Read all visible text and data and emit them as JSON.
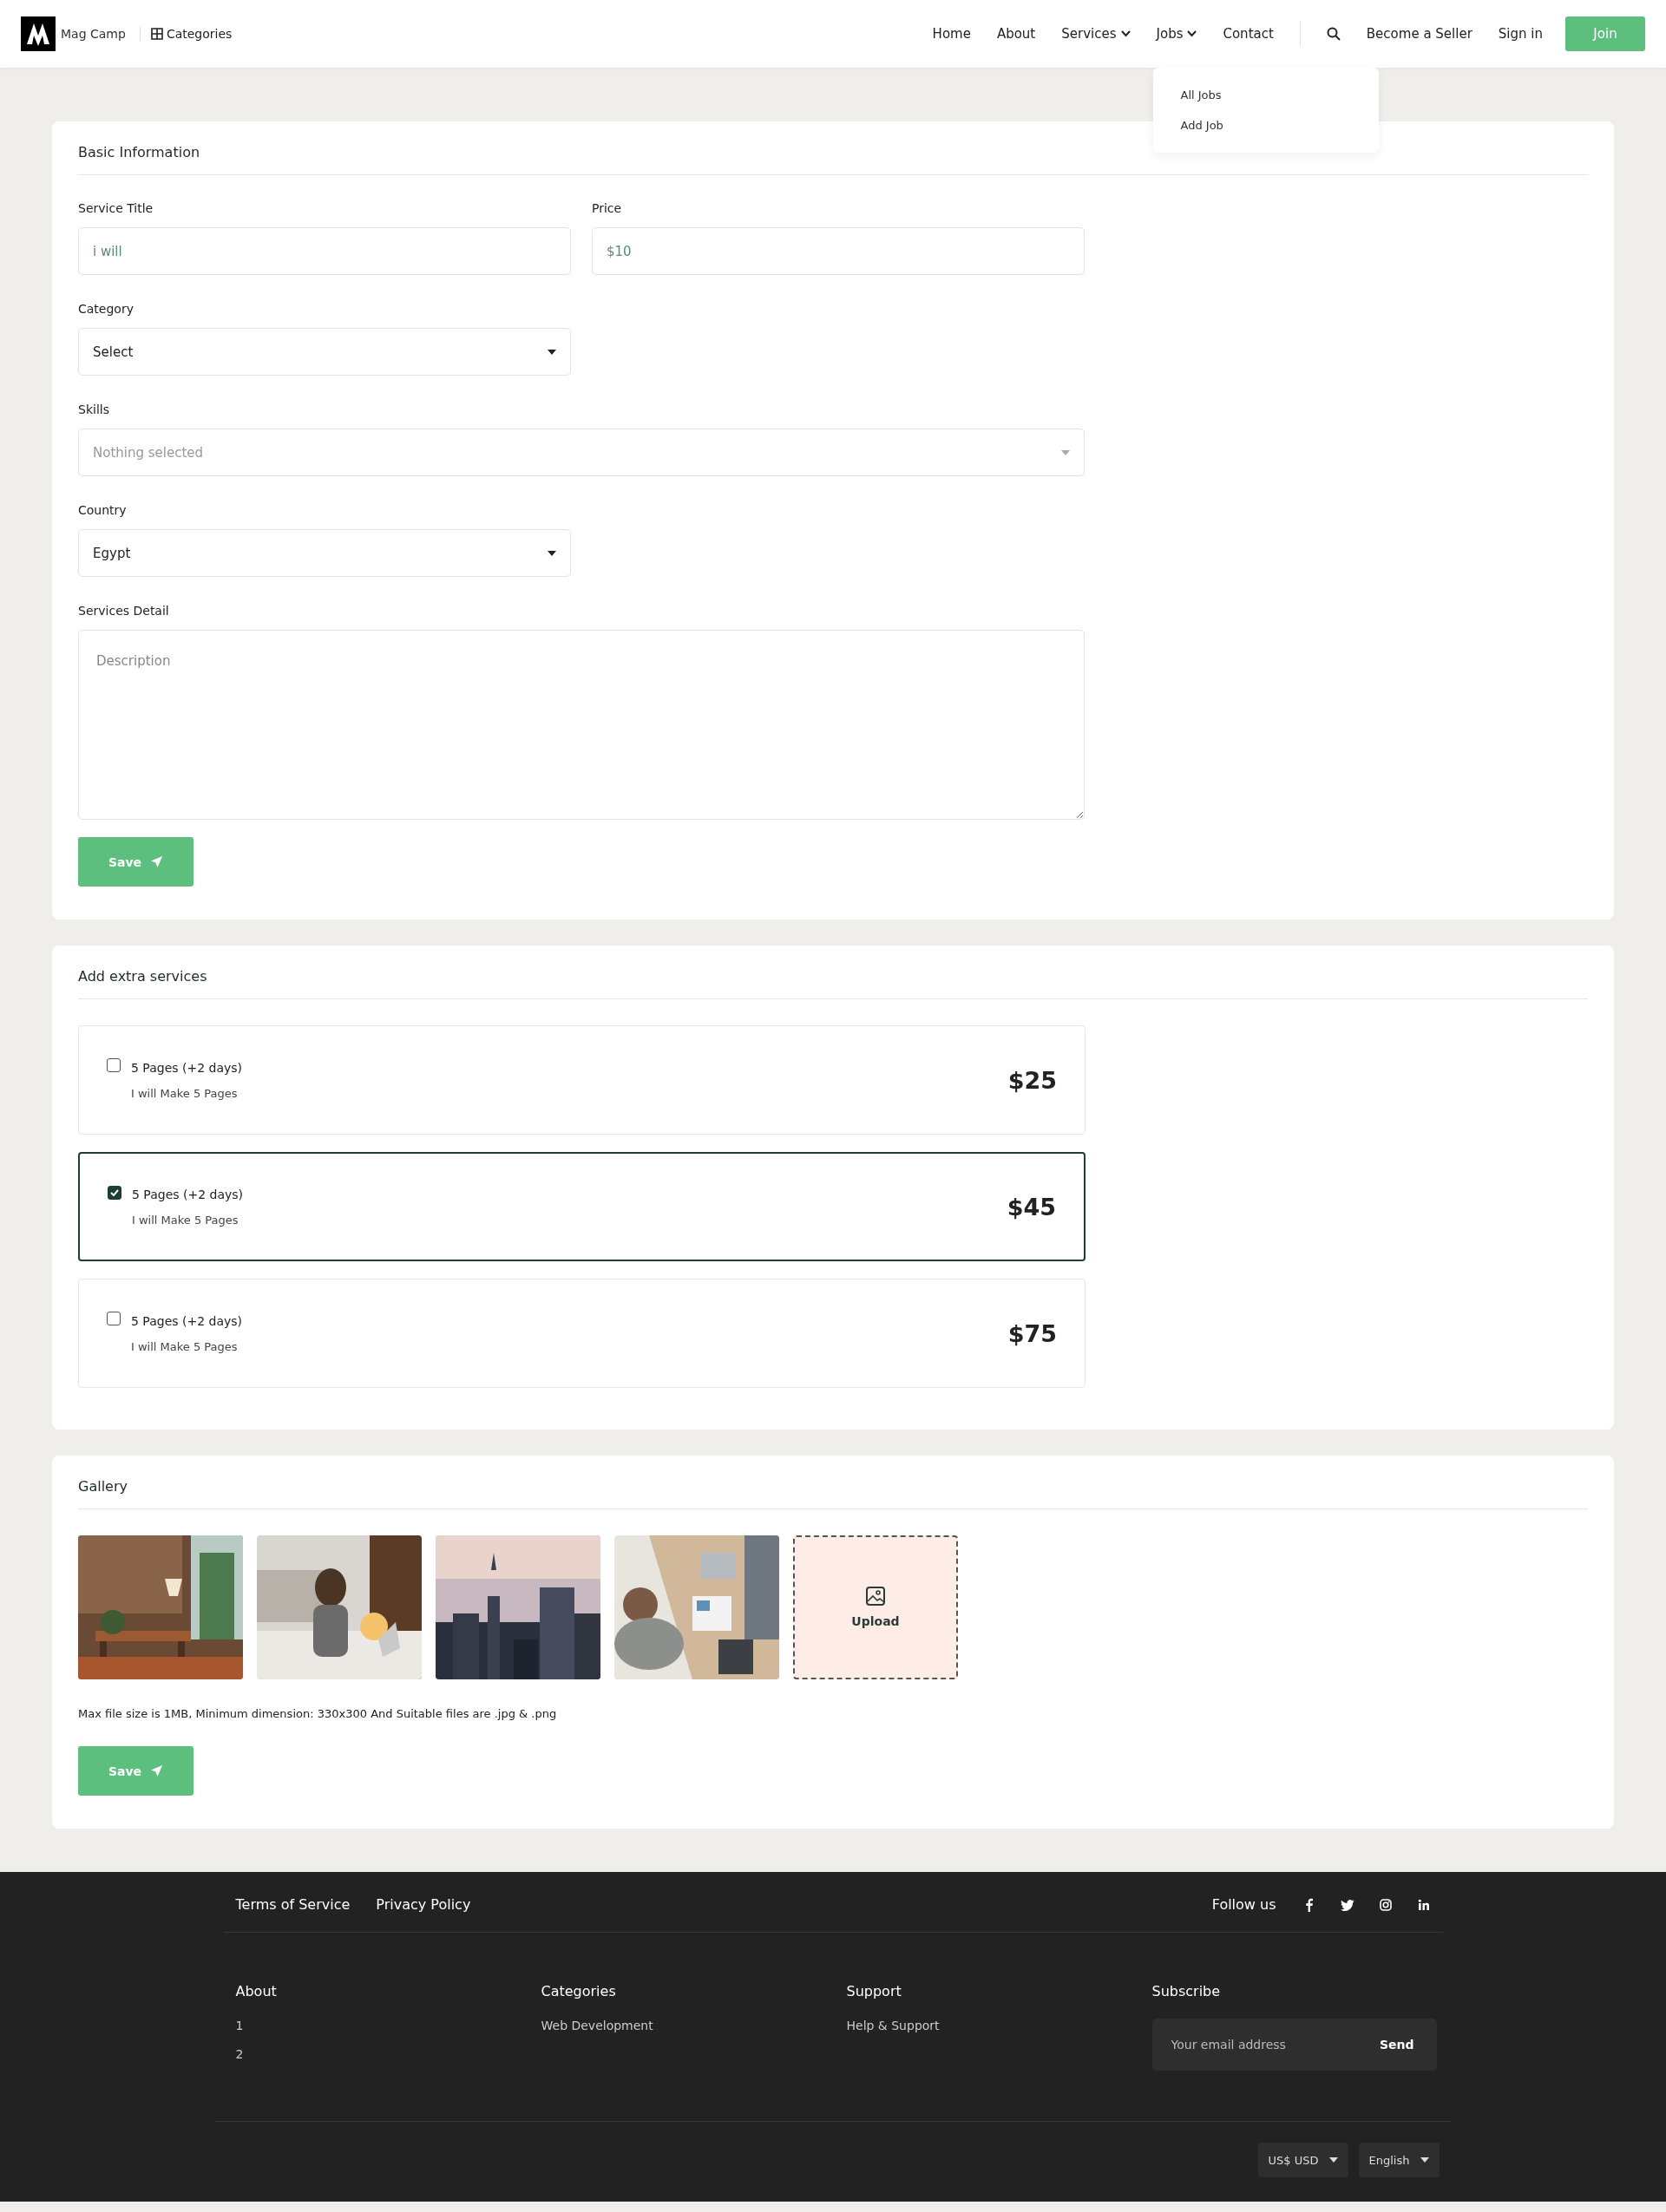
{
  "header": {
    "logo": "Mag Camp",
    "categories": "Categories",
    "nav": [
      {
        "label": "Home",
        "kind": "link"
      },
      {
        "label": "About",
        "kind": "link"
      },
      {
        "label": "Services",
        "kind": "dropdown"
      },
      {
        "label": "Jobs",
        "kind": "dropdown",
        "menu": [
          "All Jobs",
          "Add Job"
        ]
      },
      {
        "label": "Contact",
        "kind": "link"
      }
    ],
    "become_seller": "Become a Seller",
    "sign_in": "Sign in",
    "join": "Join"
  },
  "basic_information": {
    "title": "Basic Information",
    "fields": [
      {
        "label": "Service Title",
        "kind": "text",
        "placeholder": "i will"
      },
      {
        "label": "Price",
        "kind": "text",
        "placeholder": "$10"
      },
      {
        "label": "Category",
        "kind": "select",
        "value": "Select"
      },
      {
        "label": "Skills",
        "kind": "multiselect",
        "placeholder": "Nothing selected"
      },
      {
        "label": "Country",
        "kind": "select",
        "value": "Egypt"
      },
      {
        "label": "Services Detail",
        "kind": "textarea",
        "placeholder": "Description"
      }
    ],
    "save": "Save"
  },
  "extra_services": {
    "title": "Add extra services",
    "items": [
      {
        "title": "5 Pages (+2 days)",
        "description": "I will Make 5 Pages",
        "price": "$25",
        "checked": false
      },
      {
        "title": "5 Pages (+2 days)",
        "description": "I will Make 5 Pages",
        "price": "$45",
        "checked": true
      },
      {
        "title": "5 Pages (+2 days)",
        "description": "I will Make 5 Pages",
        "price": "$75",
        "checked": false
      }
    ]
  },
  "gallery": {
    "title": "Gallery",
    "upload": "Upload",
    "note": "Max file size is 1MB, Minimum dimension: 330x300 And Suitable files are .jpg & .png",
    "save": "Save"
  },
  "footer": {
    "links": [
      "Terms of Service",
      "Privacy Policy"
    ],
    "follow_us": "Follow us",
    "columns": [
      {
        "title": "About",
        "items": [
          "1",
          "2"
        ]
      },
      {
        "title": "Categories",
        "items": [
          "Web Development"
        ]
      },
      {
        "title": "Support",
        "items": [
          "Help & Support"
        ]
      }
    ],
    "subscribe": {
      "title": "Subscribe",
      "placeholder": "Your email address",
      "button": "Send"
    },
    "currency": "US$ USD",
    "language": "English"
  }
}
